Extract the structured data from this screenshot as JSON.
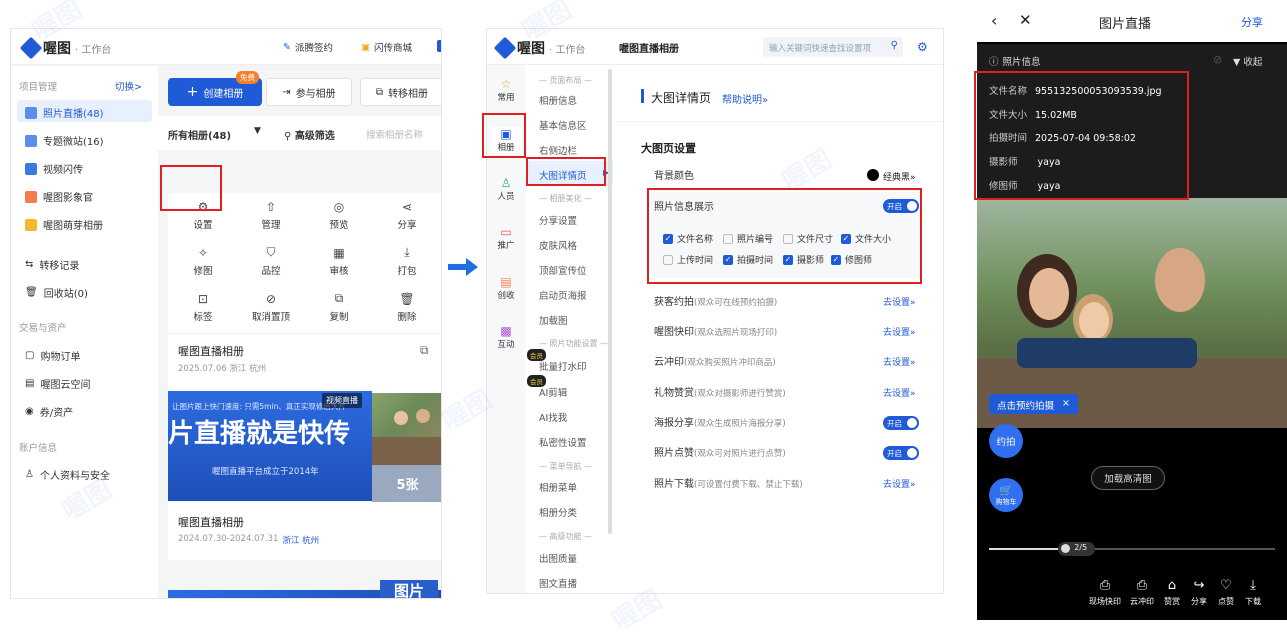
{
  "brand": {
    "name": "喔图",
    "sub": "· 工作台"
  },
  "p1": {
    "top_links": [
      {
        "icon": "sign-icon",
        "label": "派腾签约"
      },
      {
        "icon": "shop-icon",
        "label": "闪传商城"
      }
    ],
    "sidebar": {
      "group1": "项目管理",
      "switch_label": "切换>",
      "items1": [
        "照片直播(48)",
        "专题微站(16)",
        "视频闪传",
        "喔图影象官",
        "喔图萌芽相册",
        "转移记录",
        "回收站(0)"
      ],
      "group2": "交易与资产",
      "items2": [
        "购物订单",
        "喔图云空间",
        "券/资产"
      ],
      "group3": "账户信息",
      "items3": [
        "个人资料与安全"
      ]
    },
    "buttons": {
      "create": "创建相册",
      "free_badge": "免费",
      "join": "参与相册",
      "transfer": "转移相册"
    },
    "filter": {
      "all": "所有相册(48)",
      "adv": "高级筛选",
      "search_placeholder": "搜索相册名称"
    },
    "actions": [
      "设置",
      "管理",
      "预览",
      "分享",
      "修图",
      "品控",
      "审核",
      "打包",
      "标签",
      "取消置顶",
      "复制",
      "删除"
    ],
    "album1": {
      "name": "喔图直播相册",
      "meta": "2025.07.06 浙江 杭州"
    },
    "banner": {
      "line1": "让图片跟上快门速度: 只需5min、真正实现修后大片",
      "big": "片直播就是快传",
      "line3": "喔图直播平台成立于2014年",
      "badge": "视频直播",
      "count": "5张"
    },
    "album2": {
      "name": "喔图直播相册",
      "meta_date": "2024.07.30-2024.07.31",
      "meta_city": "浙江 杭州"
    },
    "banner2": {
      "text": "图片"
    }
  },
  "p2": {
    "title": "喔图直播相册",
    "search_placeholder": "输入关键词快速查找设置项",
    "leftnav": [
      "常用",
      "相册",
      "人员",
      "推广",
      "创收",
      "互动"
    ],
    "nav": {
      "h1": "— 页面布局 —",
      "items1": [
        "相册信息",
        "基本信息区",
        "右侧边栏",
        "大图详情页"
      ],
      "h2": "— 相册美化 —",
      "items2": [
        "分享设置",
        "皮肤风格",
        "顶部宣传位",
        "启动页海报",
        "加载图"
      ],
      "h3": "— 照片功能设置 —",
      "items3": [
        "批量打水印",
        "AI剪辑",
        "AI找我",
        "私密性设置"
      ],
      "h4": "— 菜单导航 —",
      "items4": [
        "相册菜单",
        "相册分类"
      ],
      "h5": "— 高级功能 —",
      "items5": [
        "出图质量",
        "图文直播"
      ],
      "member_badge": "会员"
    },
    "section_title": "大图详情页",
    "help": "帮助说明»",
    "page_setting": "大图页设置",
    "bgcolor": {
      "label": "背景颜色",
      "value": "经典黑»"
    },
    "photo_info": {
      "label": "照片信息展示",
      "toggle": "开启",
      "checks": [
        {
          "label": "文件名称",
          "on": true
        },
        {
          "label": "照片编号",
          "on": false
        },
        {
          "label": "文件尺寸",
          "on": false
        },
        {
          "label": "文件大小",
          "on": true
        },
        {
          "label": "上传时间",
          "on": false
        },
        {
          "label": "拍摄时间",
          "on": true
        },
        {
          "label": "摄影师",
          "on": true
        },
        {
          "label": "修图师",
          "on": true
        }
      ]
    },
    "rows": [
      {
        "label": "获客约拍",
        "hint": "(观众可在线预约拍摄)",
        "action": "去设置»"
      },
      {
        "label": "喔图快印",
        "hint": "(观众选照片现场打印)",
        "action": "去设置»"
      },
      {
        "label": "云冲印",
        "hint": "(观众购买照片冲印商品)",
        "action": "去设置»"
      },
      {
        "label": "礼物赞赏",
        "hint": "(观众对摄影师进行赞赏)",
        "action": "去设置»"
      },
      {
        "label": "海报分享",
        "hint": "(观众生成照片海报分享)",
        "action": "开启"
      },
      {
        "label": "照片点赞",
        "hint": "(观众可对照片进行点赞)",
        "action": "开启"
      },
      {
        "label": "照片下载",
        "hint": "(可设置付费下载、禁止下载)",
        "action": "去设置»"
      }
    ]
  },
  "p3": {
    "title": "图片直播",
    "share": "分享",
    "info_header": "照片信息",
    "collapse": "收起",
    "info": [
      {
        "k": "文件名称",
        "v": "955132500053093539.jpg"
      },
      {
        "k": "文件大小",
        "v": "15.02MB"
      },
      {
        "k": "拍摄时间",
        "v": "2025-07-04 09:58:02"
      },
      {
        "k": "摄影师",
        "v": "yaya"
      },
      {
        "k": "修图师",
        "v": "yaya"
      }
    ],
    "book_banner": "点击预约拍摄",
    "yuepai": "约拍",
    "cart": "购物车",
    "load_hd": "加载高清图",
    "page": "2/5",
    "progress": 0.27,
    "bottom": [
      "现场快印",
      "云冲印",
      "赞赏",
      "分享",
      "点赞",
      "下载"
    ]
  },
  "colors": {
    "accent": "#1f5bd7",
    "red": "#e02020"
  }
}
